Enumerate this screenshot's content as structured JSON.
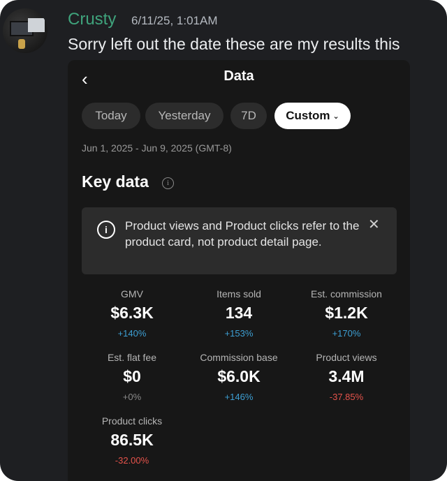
{
  "message": {
    "username": "Crusty",
    "timestamp": "6/11/25, 1:01AM",
    "text": "Sorry left out the date these are my results this"
  },
  "screenshot": {
    "back_glyph": "‹",
    "title": "Data",
    "filters": [
      "Today",
      "Yesterday",
      "7D",
      "Custom"
    ],
    "active_filter": "Custom",
    "date_range": "Jun 1, 2025 - Jun 9, 2025 (GMT-8)",
    "section_title": "Key data",
    "notice": "Product views and Product clicks refer to the product card, not product detail page.",
    "metrics": [
      {
        "label": "GMV",
        "value": "$6.3K",
        "change": "+140%"
      },
      {
        "label": "Items sold",
        "value": "134",
        "change": "+153%"
      },
      {
        "label": "Est. commission",
        "value": "$1.2K",
        "change": "+170%"
      },
      {
        "label": "Est. flat fee",
        "value": "$0",
        "change": "+0%"
      },
      {
        "label": "Commission base",
        "value": "$6.0K",
        "change": "+146%"
      },
      {
        "label": "Product views",
        "value": "3.4M",
        "change": "-37.85%"
      },
      {
        "label": "Product clicks",
        "value": "86.5K",
        "change": "-32.00%"
      }
    ]
  },
  "colors": {
    "username": "#3fa37c",
    "positive_change": "#3d9fd3",
    "negative_change": "#e5534b",
    "neutral_change": "#8a8a8a",
    "active_pill": "#ffffff"
  }
}
